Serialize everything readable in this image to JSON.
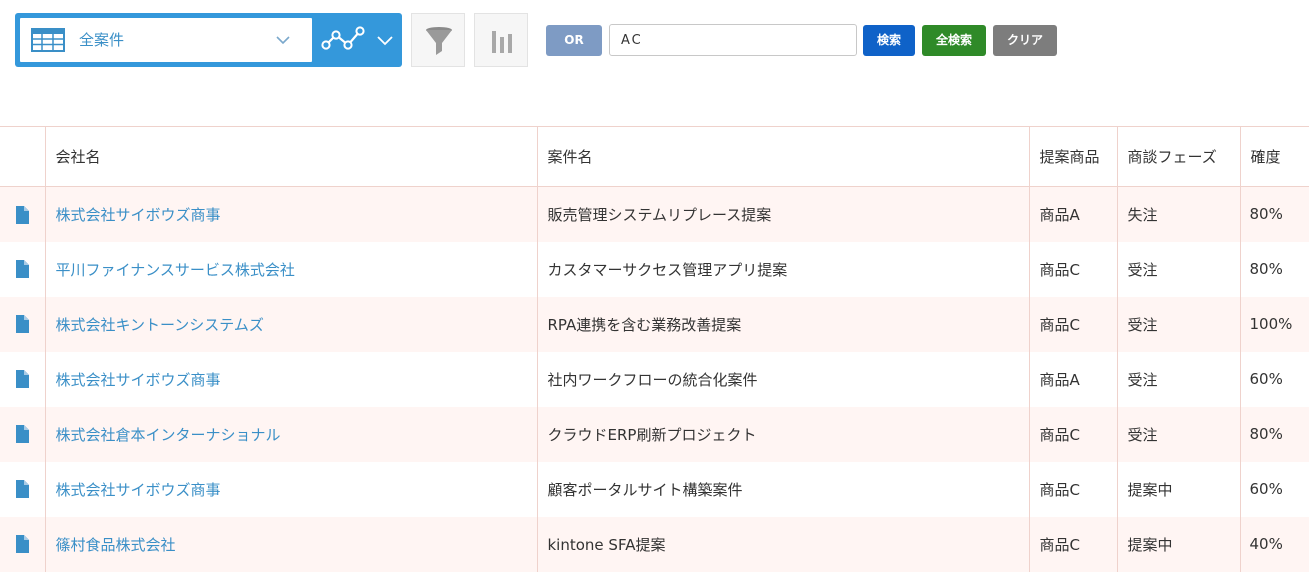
{
  "toolbar": {
    "view_label": "全案件",
    "or_label": "OR",
    "search_value": "AC",
    "search_label": "検索",
    "all_search_label": "全検索",
    "clear_label": "クリア"
  },
  "colors": {
    "accent": "#3498db",
    "link": "#3a8fc7",
    "search_button": "#0f62c8",
    "all_search_button": "#2f8a28",
    "clear_button": "#7d7d7d",
    "or_button": "#7e9bc4",
    "row_stripe": "#fff5f3",
    "grid_border": "#efd2cc"
  },
  "icons": {
    "view": "table-icon",
    "graph": "line-graph-icon",
    "filter": "funnel-icon",
    "chart": "bar-chart-icon",
    "record": "document-icon"
  },
  "table": {
    "columns": [
      "会社名",
      "案件名",
      "提案商品",
      "商談フェーズ",
      "確度"
    ],
    "rows": [
      {
        "company": "株式会社サイボウズ商事",
        "deal": "販売管理システムリプレース提案",
        "product": "商品A",
        "phase": "失注",
        "prob": "80%"
      },
      {
        "company": "平川ファイナンスサービス株式会社",
        "deal": "カスタマーサクセス管理アプリ提案",
        "product": "商品C",
        "phase": "受注",
        "prob": "80%"
      },
      {
        "company": "株式会社キントーンシステムズ",
        "deal": "RPA連携を含む業務改善提案",
        "product": "商品C",
        "phase": "受注",
        "prob": "100%"
      },
      {
        "company": "株式会社サイボウズ商事",
        "deal": "社内ワークフローの統合化案件",
        "product": "商品A",
        "phase": "受注",
        "prob": "60%"
      },
      {
        "company": "株式会社倉本インターナショナル",
        "deal": "クラウドERP刷新プロジェクト",
        "product": "商品C",
        "phase": "受注",
        "prob": "80%"
      },
      {
        "company": "株式会社サイボウズ商事",
        "deal": "顧客ポータルサイト構築案件",
        "product": "商品C",
        "phase": "提案中",
        "prob": "60%"
      },
      {
        "company": "篠村食品株式会社",
        "deal": "kintone SFA提案",
        "product": "商品C",
        "phase": "提案中",
        "prob": "40%"
      }
    ]
  }
}
